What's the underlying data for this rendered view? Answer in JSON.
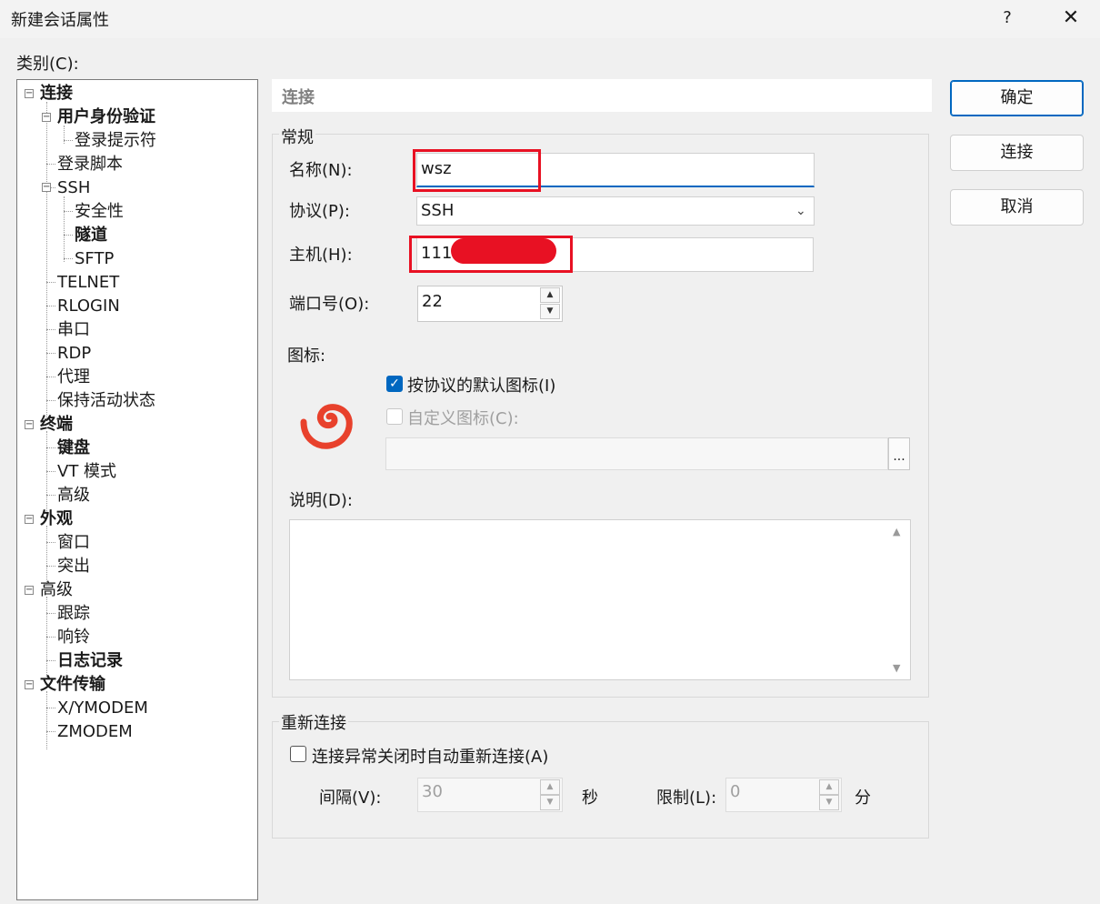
{
  "window": {
    "title": "新建会话属性",
    "help_label": "?",
    "close_label": "✕"
  },
  "category_label": "类别(C):",
  "tree": {
    "expander_minus": "−",
    "items": [
      {
        "label": "连接"
      },
      {
        "label": "用户身份验证"
      },
      {
        "label": "登录提示符"
      },
      {
        "label": "登录脚本"
      },
      {
        "label": "SSH"
      },
      {
        "label": "安全性"
      },
      {
        "label": "隧道"
      },
      {
        "label": "SFTP"
      },
      {
        "label": "TELNET"
      },
      {
        "label": "RLOGIN"
      },
      {
        "label": "串口"
      },
      {
        "label": "RDP"
      },
      {
        "label": "代理"
      },
      {
        "label": "保持活动状态"
      },
      {
        "label": "终端"
      },
      {
        "label": "键盘"
      },
      {
        "label": "VT 模式"
      },
      {
        "label": "高级"
      },
      {
        "label": "外观"
      },
      {
        "label": "窗口"
      },
      {
        "label": "突出"
      },
      {
        "label": "高级"
      },
      {
        "label": "跟踪"
      },
      {
        "label": "响铃"
      },
      {
        "label": "日志记录"
      },
      {
        "label": "文件传输"
      },
      {
        "label": "X/YMODEM"
      },
      {
        "label": "ZMODEM"
      }
    ]
  },
  "panel": {
    "header": "连接",
    "general_group": "常规",
    "name_label": "名称(N):",
    "name_value": "wsz",
    "protocol_label": "协议(P):",
    "protocol_value": "SSH",
    "host_label": "主机(H):",
    "host_value": "111.",
    "port_label": "端口号(O):",
    "port_value": "22",
    "icon_label": "图标:",
    "default_icon_label": "按协议的默认图标(I)",
    "custom_icon_label": "自定义图标(C):",
    "custom_icon_path": "",
    "browse_label": "...",
    "desc_label": "说明(D):",
    "desc_value": ""
  },
  "reconnect": {
    "group": "重新连接",
    "auto_label": "连接异常关闭时自动重新连接(A)",
    "interval_label": "间隔(V):",
    "interval_value": "30",
    "interval_unit": "秒",
    "limit_label": "限制(L):",
    "limit_value": "0",
    "limit_unit": "分"
  },
  "buttons": {
    "ok": "确定",
    "connect": "连接",
    "cancel": "取消"
  },
  "colors": {
    "accent": "#0067c0",
    "annotation": "#e81123",
    "logo": "#e8412c"
  }
}
